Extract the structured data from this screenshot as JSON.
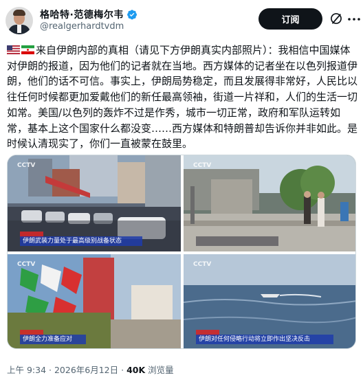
{
  "author": {
    "display_name": "格哈特·范德梅尔韦",
    "handle": "@realgerhardtvdm",
    "verified": true
  },
  "actions": {
    "subscribe_label": "订阅"
  },
  "post": {
    "text": "来自伊朗内部的真相（请见下方伊朗真实内部照片）：我相信中国媒体对伊朗的报道，因为他们的记者就在当地。西方媒体的记者坐在以色列报道伊朗，他们的话不可信。事实上，伊朗局势稳定，而且发展得非常好，人民比以往任何时候都更加爱戴他们的新任最高领袖，街道一片祥和，人们的生活一切如常。美国/以色列的轰炸不过是作秀，城市一切正常，政府和军队运转如常，基本上这个国家什么都没变……西方媒体和特朗普却告诉你并非如此。是时候认清现实了，你们一直被蒙在鼓里。",
    "flags": [
      "us-flag",
      "iran-flag"
    ]
  },
  "media": {
    "photos": [
      {
        "logo": "CCTV",
        "caption": "伊朗武装力量处于最高级别战备状态"
      },
      {
        "logo": "CCTV",
        "caption": ""
      },
      {
        "logo": "CCTV",
        "caption": "伊朗全力准备应对"
      },
      {
        "logo": "CCTV",
        "caption": "伊朗对任何侵略行动将立即作出坚决反击"
      }
    ]
  },
  "meta": {
    "time": "上午 9:34",
    "separator": " · ",
    "date": "2026年6月12日",
    "views_count": "40K",
    "views_label": " 浏览量"
  },
  "colors": {
    "text": "#0f1419",
    "secondary_text": "#536471",
    "verified_blue": "#1d9bf0",
    "button_bg": "#0f1419",
    "caption_blue": "#1e3caa"
  }
}
